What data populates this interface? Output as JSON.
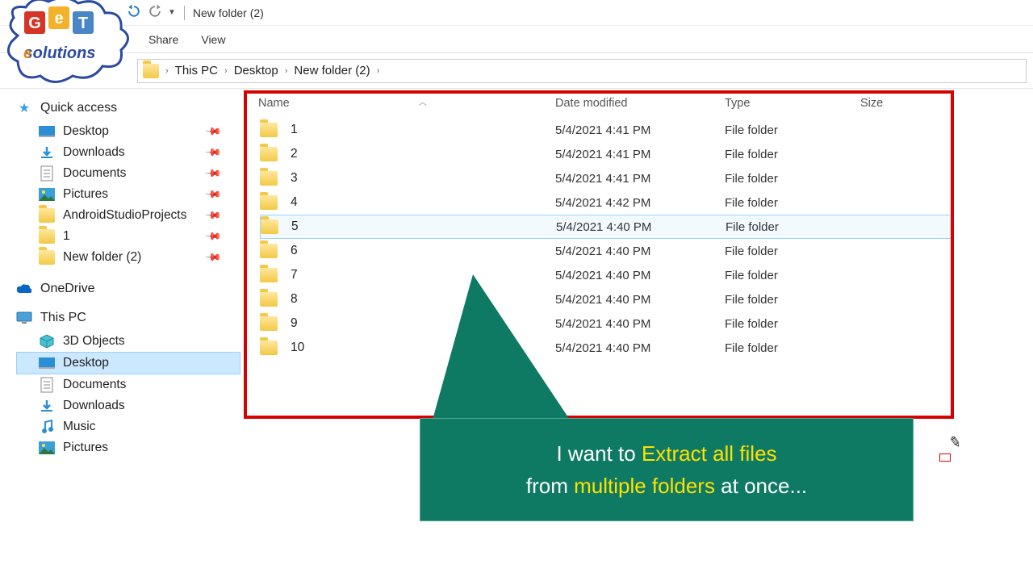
{
  "title": "New folder (2)",
  "tabs": {
    "share": "Share",
    "view": "View"
  },
  "breadcrumb": [
    "This PC",
    "Desktop",
    "New folder (2)"
  ],
  "sidebar": {
    "quick": {
      "head": "Quick access",
      "items": [
        "Desktop",
        "Downloads",
        "Documents",
        "Pictures",
        "AndroidStudioProjects",
        "1",
        "New folder (2)"
      ]
    },
    "onedrive": "OneDrive",
    "thispc": {
      "head": "This PC",
      "items": [
        "3D Objects",
        "Desktop",
        "Documents",
        "Downloads",
        "Music",
        "Pictures"
      ]
    }
  },
  "columns": {
    "name": "Name",
    "date": "Date modified",
    "type": "Type",
    "size": "Size"
  },
  "rows": [
    {
      "name": "1",
      "date": "5/4/2021 4:41 PM",
      "type": "File folder"
    },
    {
      "name": "2",
      "date": "5/4/2021 4:41 PM",
      "type": "File folder"
    },
    {
      "name": "3",
      "date": "5/4/2021 4:41 PM",
      "type": "File folder"
    },
    {
      "name": "4",
      "date": "5/4/2021 4:42 PM",
      "type": "File folder"
    },
    {
      "name": "5",
      "date": "5/4/2021 4:40 PM",
      "type": "File folder",
      "hilite": true
    },
    {
      "name": "6",
      "date": "5/4/2021 4:40 PM",
      "type": "File folder"
    },
    {
      "name": "7",
      "date": "5/4/2021 4:40 PM",
      "type": "File folder"
    },
    {
      "name": "8",
      "date": "5/4/2021 4:40 PM",
      "type": "File folder"
    },
    {
      "name": "9",
      "date": "5/4/2021 4:40 PM",
      "type": "File folder"
    },
    {
      "name": "10",
      "date": "5/4/2021 4:40 PM",
      "type": "File folder"
    }
  ],
  "callout": {
    "l1a": "I want to ",
    "l1b": "Extract all files",
    "l2a": "from ",
    "l2b": "multiple folders",
    "l2c": " at once..."
  }
}
